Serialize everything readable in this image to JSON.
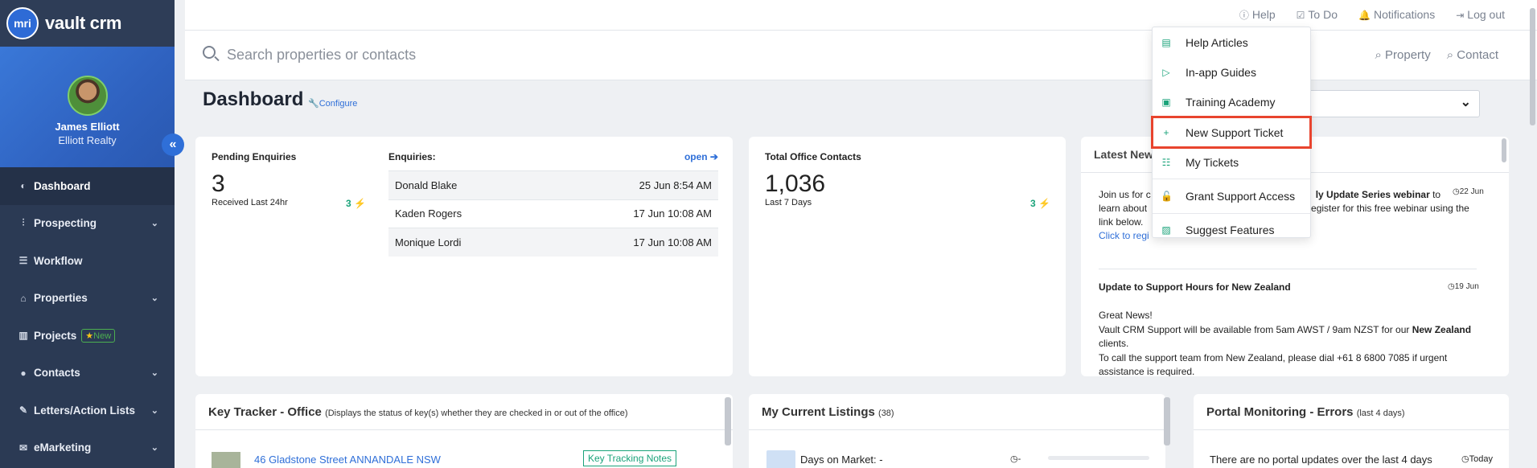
{
  "brand": {
    "logo": "mri",
    "name": "vault crm"
  },
  "profile": {
    "name": "James Elliott",
    "org": "Elliott Realty"
  },
  "sidebar": {
    "collapse_icon": "«",
    "items": [
      {
        "label": "Dashboard",
        "icon": "◐",
        "active": true
      },
      {
        "label": "Prospecting",
        "icon": "⫶",
        "chevron": "⌄"
      },
      {
        "label": "Workflow",
        "icon": "☰"
      },
      {
        "label": "Properties",
        "icon": "⌂",
        "chevron": "⌄"
      },
      {
        "label": "Projects",
        "icon": "▥",
        "badge": "New",
        "badge_star": "★"
      },
      {
        "label": "Contacts",
        "icon": "●",
        "chevron": "⌄"
      },
      {
        "label": "Letters/Action Lists",
        "icon": "✎",
        "chevron": "⌄"
      },
      {
        "label": "eMarketing",
        "icon": "✉",
        "chevron": "⌄"
      }
    ]
  },
  "topbar": {
    "help": "Help",
    "todo": "To Do",
    "notifications": "Notifications",
    "logout": "Log out"
  },
  "search": {
    "placeholder": "Search properties or contacts",
    "scope_property": "Property",
    "scope_contact": "Contact"
  },
  "dashboard": {
    "title": "Dashboard",
    "configure": "Configure"
  },
  "pending": {
    "title": "Pending Enquiries",
    "count": "3",
    "sub": "Received Last 24hr",
    "badge": "3 ⚡",
    "enq_label": "Enquiries:",
    "open_label": "open ➔",
    "rows": [
      {
        "name": "Donald Blake",
        "date": "25 Jun 8:54 AM"
      },
      {
        "name": "Kaden Rogers",
        "date": "17 Jun 10:08 AM"
      },
      {
        "name": "Monique Lordi",
        "date": "17 Jun 10:08 AM"
      }
    ]
  },
  "contacts": {
    "title": "Total Office Contacts",
    "count": "1,036",
    "sub": "Last 7 Days",
    "badge": "3 ⚡"
  },
  "news": {
    "title": "Latest New",
    "item1_text_a": "Join us for c",
    "item1_bold": "ly Update Series webinar",
    "item1_text_b": " to",
    "item1_line2_a": "learn about",
    "item1_line2_b": "egister for this free webinar using the",
    "item1_line3": "link below.",
    "item1_link": "Click to regi",
    "item1_date": "◷22 Jun",
    "item2_title": "Update to Support Hours for New Zealand",
    "item2_date": "◷19 Jun",
    "item2_p1": "Great News!",
    "item2_p2_a": "Vault CRM Support will be available from 5am AWST / 9am NZST for our ",
    "item2_p2_bold": "New Zealand",
    "item2_p2_b": " clients.",
    "item2_p3": "To call the support team from New Zealand, please dial +61 8 6800 7085 if urgent assistance is required."
  },
  "keytracker": {
    "title": "Key Tracker - Office",
    "subtitle": "(Displays the status of key(s) whether they are checked in or out of the office)",
    "row_address": "46 Gladstone Street ANNANDALE NSW",
    "notes_button": "Key Tracking Notes"
  },
  "listings": {
    "title": "My Current Listings",
    "count": "(38)",
    "row_text": "Days on Market: -",
    "row_dot": "◷-"
  },
  "portal": {
    "title": "Portal Monitoring - Errors",
    "subtitle": "(last 4 days)",
    "message": "There are no portal updates over the last 4 days",
    "date": "◷Today"
  },
  "help_menu": {
    "items": [
      {
        "label": "Help Articles",
        "icon": "▤"
      },
      {
        "label": "In-app Guides",
        "icon": "▷"
      },
      {
        "label": "Training Academy",
        "icon": "▣"
      },
      {
        "label": "New Support Ticket",
        "icon": "+",
        "highlight": true
      },
      {
        "label": "My Tickets",
        "icon": "☷"
      },
      {
        "label": "Grant Support Access",
        "icon": "🔓"
      },
      {
        "label": "Suggest Features",
        "icon": "▨"
      }
    ]
  },
  "colors": {
    "sidebar": "#2b3a54",
    "accent": "#2f6fd8",
    "green": "#1aa37a",
    "highlight": "#e8442e"
  }
}
